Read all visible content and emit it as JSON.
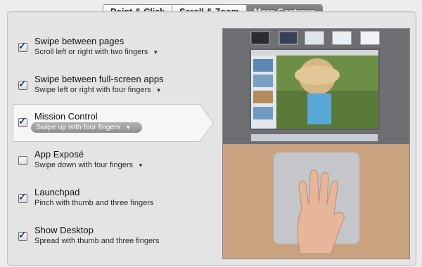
{
  "tabs": [
    {
      "label": "Point & Click",
      "selected": false
    },
    {
      "label": "Scroll & Zoom",
      "selected": false
    },
    {
      "label": "More Gestures",
      "selected": true
    }
  ],
  "options": [
    {
      "title": "Swipe between pages",
      "subtitle": "Scroll left or right with two fingers",
      "checked": true,
      "has_menu": true
    },
    {
      "title": "Swipe between full-screen apps",
      "subtitle": "Swipe left or right with four fingers",
      "checked": true,
      "has_menu": true
    },
    {
      "title": "Mission Control",
      "subtitle": "Swipe up with four fingers",
      "checked": true,
      "has_menu": true,
      "selected": true
    },
    {
      "title": "App Exposé",
      "subtitle": "Swipe down with four fingers",
      "checked": false,
      "has_menu": true
    },
    {
      "title": "Launchpad",
      "subtitle": "Pinch with thumb and three fingers",
      "checked": true,
      "has_menu": false
    },
    {
      "title": "Show Desktop",
      "subtitle": "Spread with thumb and three fingers",
      "checked": true,
      "has_menu": false
    }
  ],
  "glyphs": {
    "check": "✓",
    "menu_arrow": "▼"
  },
  "colors": {
    "window_bg": "#ececec",
    "selected_tab_bg": "#777777",
    "selected_row_bg": "#f6f6f6",
    "subtitle_pill": "#9e9e9e",
    "preview_gray": "#6f6f74",
    "trackpad_wood": "#c9a27f"
  }
}
